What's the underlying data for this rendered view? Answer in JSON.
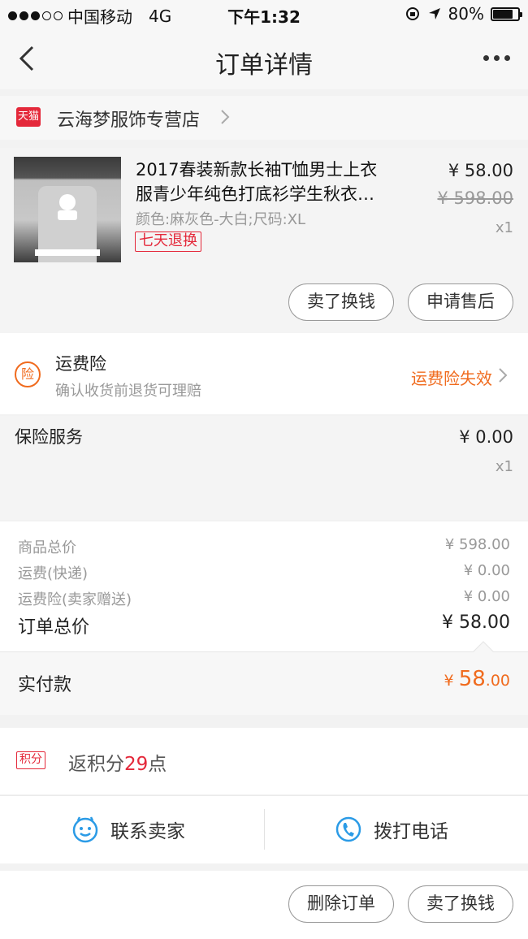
{
  "status_bar": {
    "carrier": "中国移动",
    "network": "4G",
    "time": "下午1:32",
    "battery": "80%"
  },
  "nav": {
    "title": "订单详情"
  },
  "shop": {
    "badge": "天猫",
    "name": "云海梦服饰专营店"
  },
  "product": {
    "title_line1": "2017春装新款长袖T恤男士上衣",
    "title_line2": "服青少年纯色打底衫学生秋衣…",
    "spec": "颜色:麻灰色-大白;尺码:XL",
    "return_badge": "七天退换",
    "price": "¥ 58.00",
    "original_price": "¥ 598.00",
    "quantity": "x1",
    "sell_button": "卖了换钱",
    "after_sale_button": "申请售后"
  },
  "freight_insurance": {
    "icon_label": "险",
    "title": "运费险",
    "subtitle": "确认收货前退货可理赔",
    "status": "运费险失效"
  },
  "insurance_service": {
    "title": "保险服务",
    "price": "¥ 0.00",
    "quantity": "x1"
  },
  "summary": {
    "rows": [
      {
        "label": "商品总价",
        "value": "¥ 598.00"
      },
      {
        "label": "运费(快递)",
        "value": "¥ 0.00"
      },
      {
        "label": "运费险(卖家赠送)",
        "value": "¥ 0.00"
      }
    ],
    "total_label": "订单总价",
    "total_value": "¥ 58.00",
    "paid_label": "实付款",
    "paid_currency": "¥ ",
    "paid_integer": "58",
    "paid_decimal": ".00"
  },
  "points": {
    "badge": "积分",
    "prefix": "返积分",
    "value": "29",
    "suffix": "点"
  },
  "contact": {
    "seller_label": "联系卖家",
    "call_label": "拨打电话"
  },
  "actions": {
    "delete_label": "删除订单",
    "sell_label": "卖了换钱"
  },
  "colors": {
    "accent_orange": "#f06b1e",
    "tmall_red": "#e4283a",
    "contact_blue": "#2b9be6"
  },
  "icons": [
    "back-icon",
    "more-icon",
    "tmall-icon",
    "chevron-right-icon",
    "insurance-icon",
    "chat-face-icon",
    "phone-icon"
  ]
}
